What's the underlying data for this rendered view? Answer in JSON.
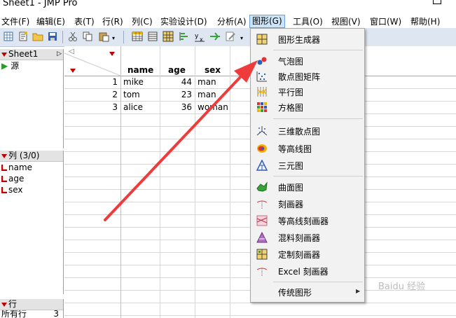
{
  "window": {
    "title": "Sheet1 - JMP Pro"
  },
  "menubar": {
    "items": [
      "文件(F)",
      "编辑(E)",
      "表(T)",
      "行(R)",
      "列(C)",
      "实验设计(D)",
      "分析(A)",
      "图形(G)",
      "工具(O)",
      "视图(V)",
      "窗口(W)",
      "帮助(H)"
    ],
    "active": "图形(G)"
  },
  "left_panel": {
    "table_name": "Sheet1",
    "source_label": "源",
    "columns_header": "列 (3/0)",
    "columns": [
      "name",
      "age",
      "sex"
    ],
    "rows_header": "行",
    "rows_all_label": "所有行",
    "rows_all_count": "3"
  },
  "grid": {
    "headers": [
      "name",
      "age",
      "sex"
    ],
    "rows": [
      {
        "num": "1",
        "name": "mike",
        "age": "44",
        "sex": "man"
      },
      {
        "num": "2",
        "name": "tom",
        "age": "23",
        "sex": "man"
      },
      {
        "num": "3",
        "name": "alice",
        "age": "36",
        "sex": "woman"
      }
    ]
  },
  "graph_menu": {
    "items": [
      {
        "label": "图形生成器",
        "icon": "graph-builder-icon"
      },
      {
        "label": "气泡图",
        "icon": "bubble-plot-icon"
      },
      {
        "label": "散点图矩阵",
        "icon": "scatterplot-matrix-icon"
      },
      {
        "label": "平行图",
        "icon": "parallel-plot-icon"
      },
      {
        "label": "方格图",
        "icon": "cell-plot-icon"
      },
      {
        "label": "三维散点图",
        "icon": "scatterplot-3d-icon"
      },
      {
        "label": "等高线图",
        "icon": "contour-plot-icon"
      },
      {
        "label": "三元图",
        "icon": "ternary-plot-icon"
      },
      {
        "label": "曲面图",
        "icon": "surface-plot-icon"
      },
      {
        "label": "刻画器",
        "icon": "profiler-icon"
      },
      {
        "label": "等高线刻画器",
        "icon": "contour-profiler-icon"
      },
      {
        "label": "混料刻画器",
        "icon": "mixture-profiler-icon"
      },
      {
        "label": "定制刻画器",
        "icon": "custom-profiler-icon"
      },
      {
        "label": "Excel 刻画器",
        "icon": "excel-profiler-icon"
      },
      {
        "label": "传统图形",
        "icon": "submenu-arrow-icon"
      }
    ]
  },
  "watermark": "Baidu 经验"
}
